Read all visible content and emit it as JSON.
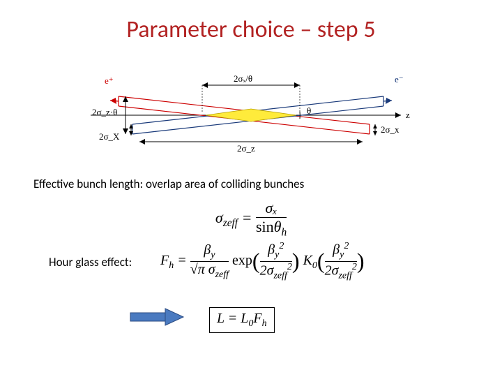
{
  "title": "Parameter choice – step 5",
  "diagram": {
    "left_particle": "e⁺",
    "right_particle": "e⁻",
    "z_axis": "z",
    "angle_label": "θ",
    "top_width": "2σₓ/θ",
    "bottom_width": "2σ_z",
    "left_height": "2σ_z·θ",
    "left_bottom": "2σ_X",
    "right_height": "2σ_x"
  },
  "caption1": "Effective bunch length:   overlap area of colliding bunches",
  "formula1": {
    "lhs": "σ",
    "lhs_sub": "zeff",
    "num": "σₓ",
    "den_pre": "sin",
    "den_var": "θ",
    "den_sub": "h"
  },
  "caption2": "Hour glass effect:",
  "formula2": {
    "text": "Fₕ = βy/(√π σ_zeff) · exp(βy²/2σ_zeff²) · K₀(βy²/2σ_zeff²)"
  },
  "formula3": {
    "text": "L = L₀Fₕ"
  }
}
